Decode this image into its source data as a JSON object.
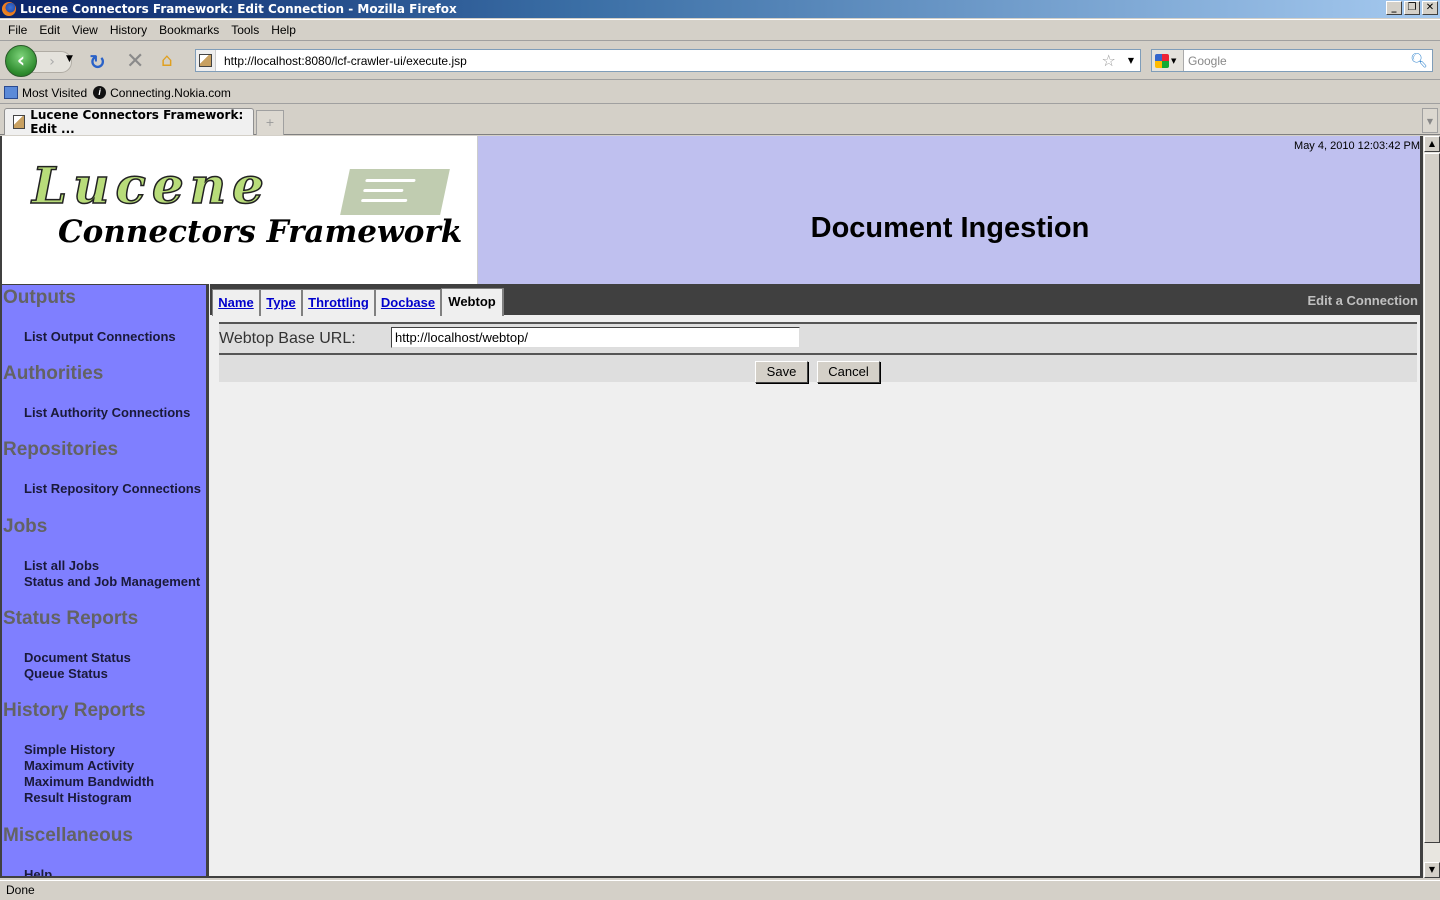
{
  "window": {
    "title": "Lucene Connectors Framework: Edit Connection - Mozilla Firefox",
    "controls": [
      "minimize",
      "restore",
      "close"
    ]
  },
  "menu": [
    "File",
    "Edit",
    "View",
    "History",
    "Bookmarks",
    "Tools",
    "Help"
  ],
  "nav": {
    "url": "http://localhost:8080/lcf-crawler-ui/execute.jsp",
    "search_placeholder": "Google"
  },
  "bookmarks": [
    {
      "label": "Most Visited",
      "icon": "folder-icon"
    },
    {
      "label": "Connecting.Nokia.com",
      "icon": "info-icon"
    }
  ],
  "tabs": [
    {
      "label": "Lucene Connectors Framework: Edit ...",
      "active": true
    }
  ],
  "header": {
    "logo_text_1": "Lucene",
    "logo_text_2": "Connectors Framework",
    "timestamp": "May 4, 2010 12:03:42 PM",
    "title": "Document Ingestion"
  },
  "sidebar": {
    "sections": [
      {
        "title": "Outputs",
        "links": [
          "List Output Connections"
        ]
      },
      {
        "title": "Authorities",
        "links": [
          "List Authority Connections"
        ]
      },
      {
        "title": "Repositories",
        "links": [
          "List Repository Connections"
        ]
      },
      {
        "title": "Jobs",
        "links": [
          "List all Jobs",
          "Status and Job Management"
        ]
      },
      {
        "title": "Status Reports",
        "links": [
          "Document Status",
          "Queue Status"
        ]
      },
      {
        "title": "History Reports",
        "links": [
          "Simple History",
          "Maximum Activity",
          "Maximum Bandwidth",
          "Result Histogram"
        ]
      },
      {
        "title": "Miscellaneous",
        "links": [
          "Help"
        ]
      }
    ]
  },
  "content": {
    "tabs": [
      {
        "label": "Name",
        "active": false
      },
      {
        "label": "Type",
        "active": false
      },
      {
        "label": "Throttling",
        "active": false
      },
      {
        "label": "Docbase",
        "active": false
      },
      {
        "label": "Webtop",
        "active": true
      }
    ],
    "page_label": "Edit a Connection",
    "field_label": "Webtop Base URL:",
    "field_value": "http://localhost/webtop/",
    "save_label": "Save",
    "cancel_label": "Cancel"
  },
  "status": "Done"
}
